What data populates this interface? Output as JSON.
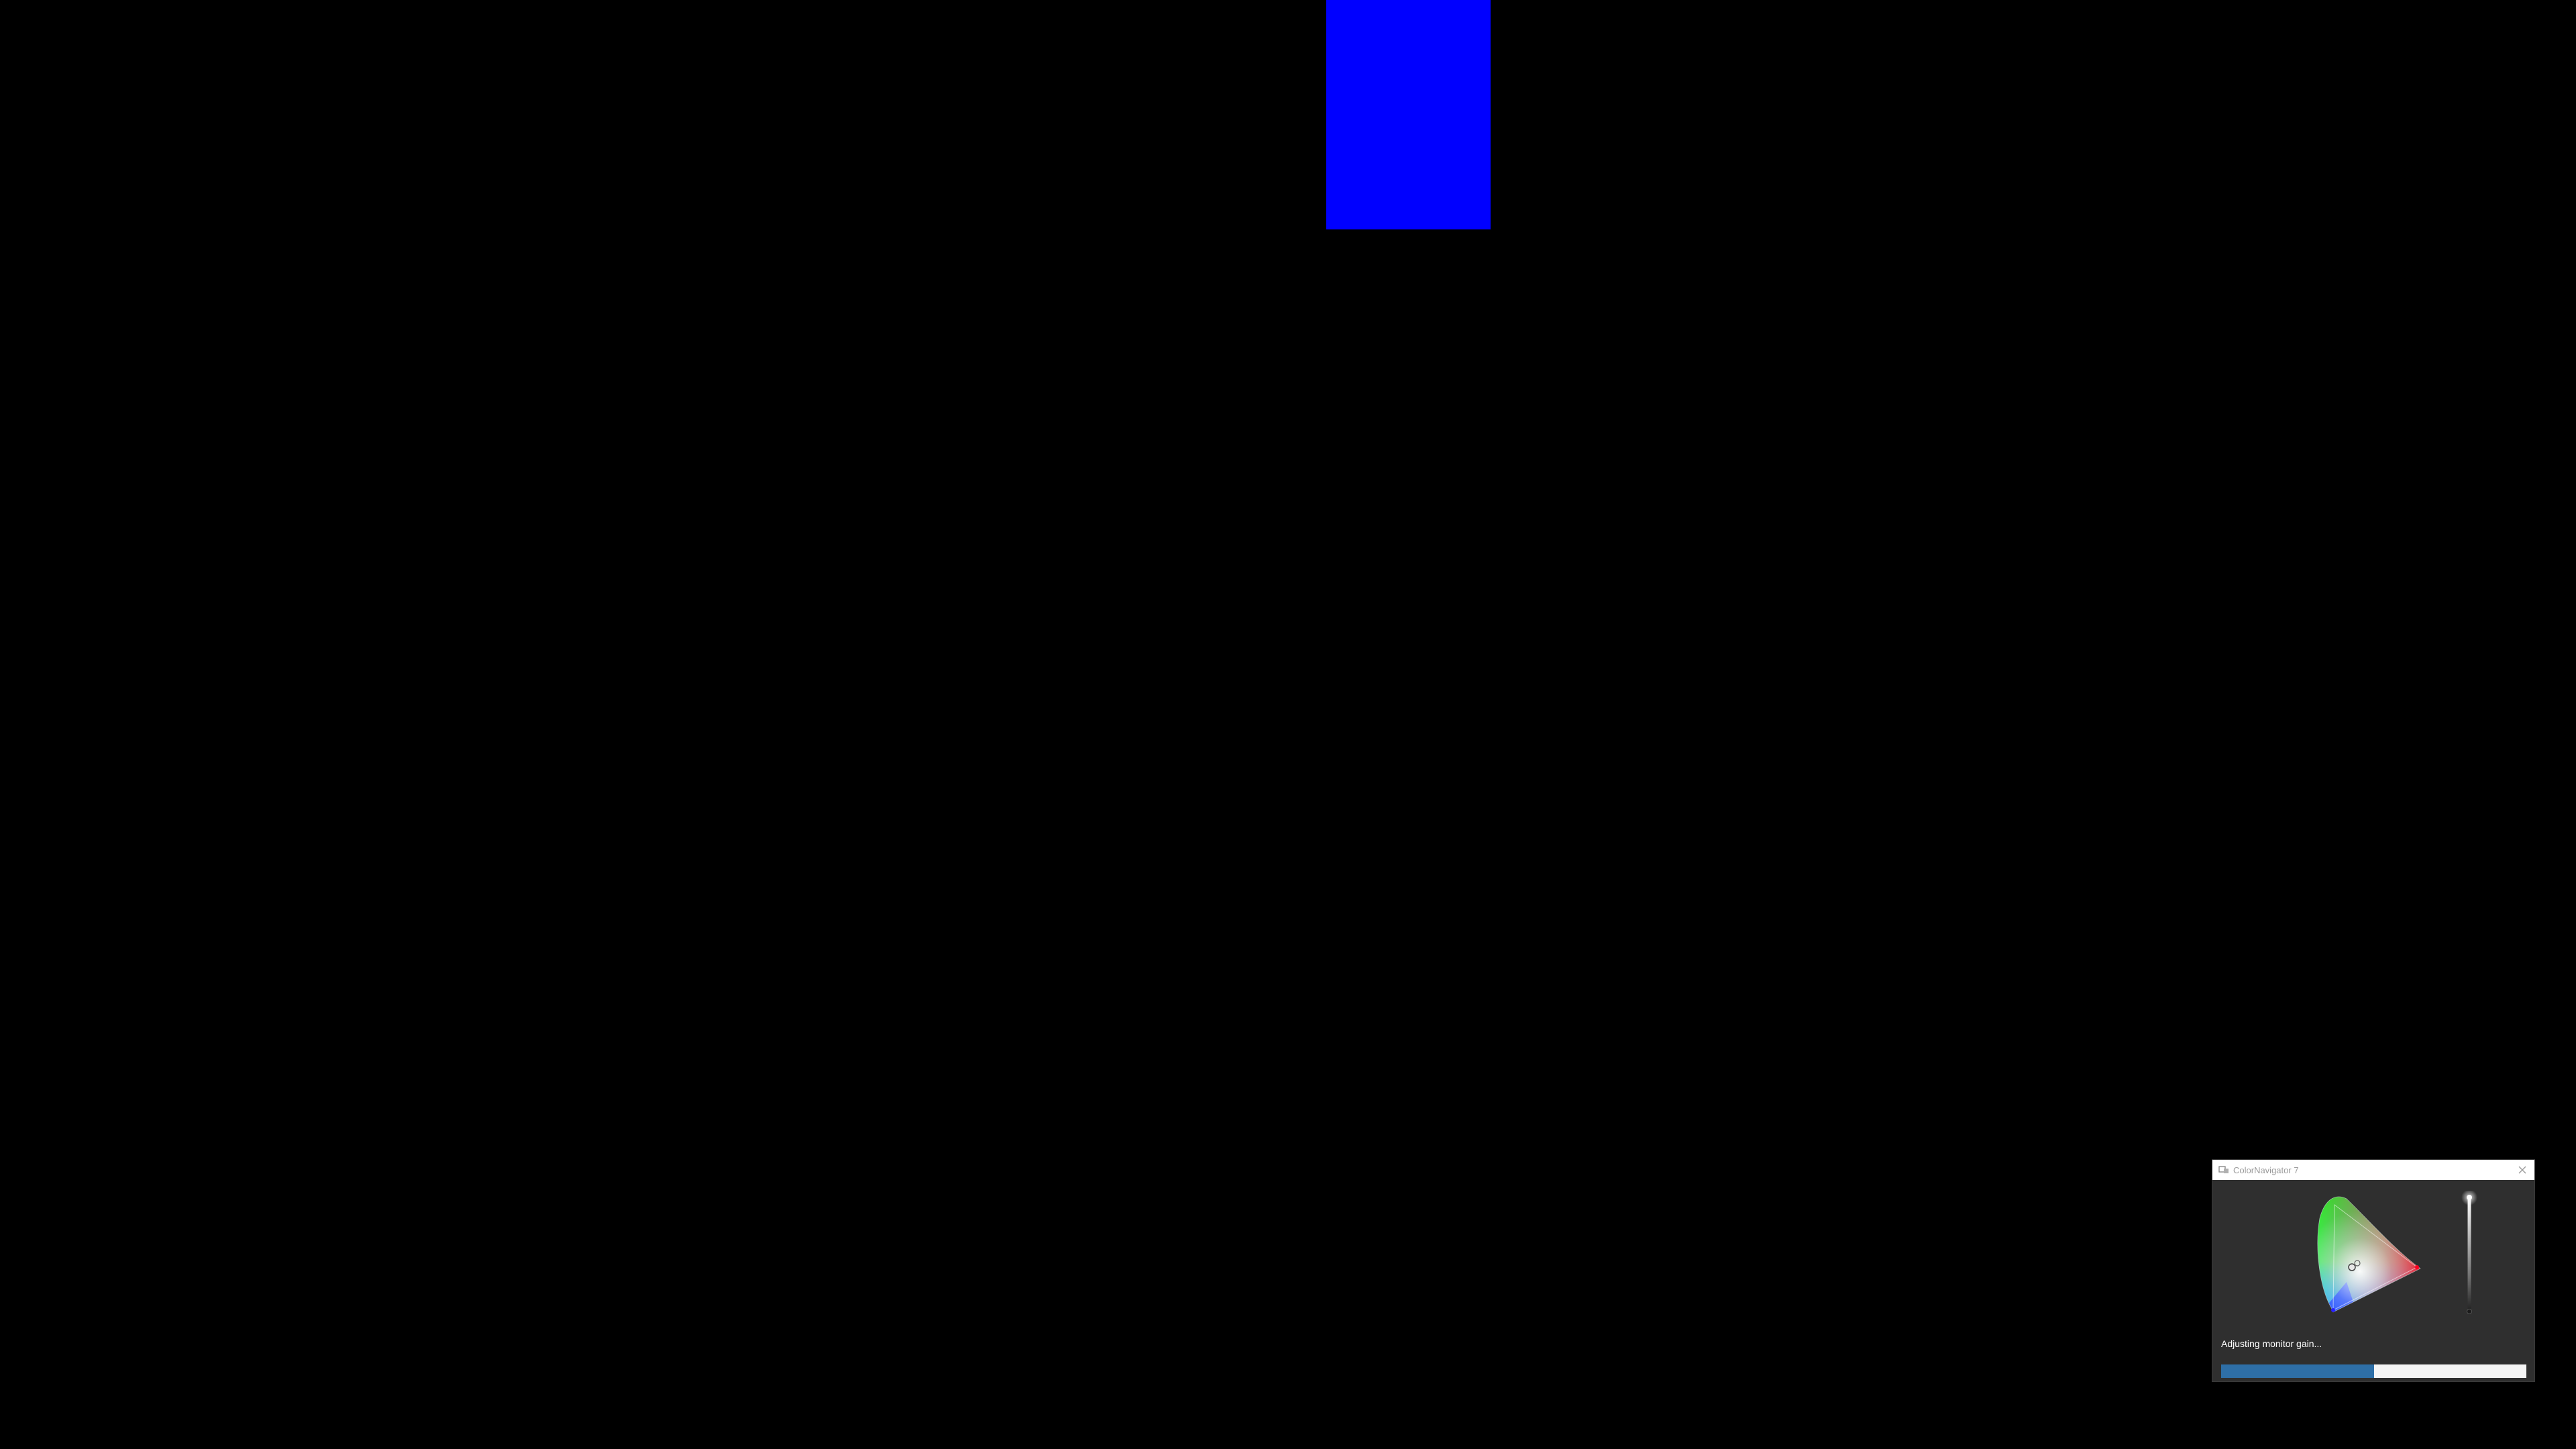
{
  "screen": {
    "background_color": "#000000",
    "patch_color": "#0000ff"
  },
  "window": {
    "title": "ColorNavigator 7",
    "app_icon": "colornavigator-app-icon",
    "close_icon": "close-icon",
    "status_text": "Adjusting monitor gain...",
    "progress": 0.5,
    "progress_color": "#2e6fa7"
  }
}
